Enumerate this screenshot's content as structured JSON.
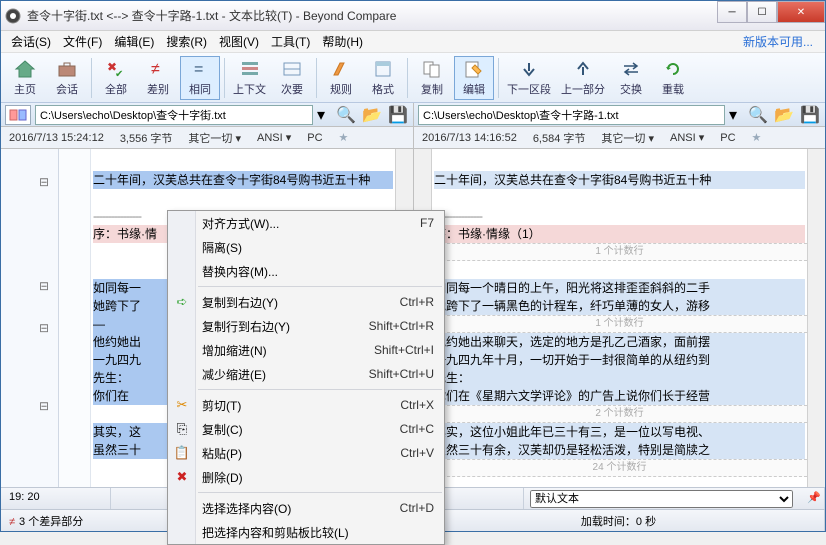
{
  "window": {
    "title": "查令十字街.txt <--> 查令十字路-1.txt - 文本比较(T) - Beyond Compare"
  },
  "menu": {
    "items": [
      "会话(S)",
      "文件(F)",
      "编辑(E)",
      "搜索(R)",
      "视图(V)",
      "工具(T)",
      "帮助(H)"
    ],
    "update": "新版本可用..."
  },
  "toolbar": {
    "home": "主页",
    "session": "会话",
    "all": "全部",
    "diff": "差别",
    "same": "相同",
    "ctx": "上下文",
    "minor": "次要",
    "rules": "规则",
    "format": "格式",
    "copy": "复制",
    "edit": "编辑",
    "nextsec": "下一区段",
    "prevpart": "上一部分",
    "swap": "交换",
    "reload": "重载"
  },
  "left": {
    "path": "C:\\Users\\echo\\Desktop\\查令十字街.txt",
    "ts": "2016/7/13 15:24:12",
    "size": "3,556 字节",
    "enc": "其它一切",
    "charset": "ANSI",
    "eol": "PC",
    "lines": {
      "l1": "二十年间，汉芙总共在查令十字街84号购书近五十种",
      "dash": "----------------",
      "seq": "序：书缘·情",
      "a": "如同每一",
      "b": "她跨下了",
      "c": "—",
      "d": "他约她出",
      "e": "一九四九",
      "f": "先生：",
      "g": "你们在",
      "h": "其实，这",
      "i": "虽然三十"
    }
  },
  "right": {
    "path": "C:\\Users\\echo\\Desktop\\查令十字路-1.txt",
    "ts": "2016/7/13 14:16:52",
    "size": "6,584 字节",
    "enc": "其它一切",
    "charset": "ANSI",
    "eol": "PC",
    "lines": {
      "l1": "二十年间，汉芙总共在查令十字街84号购书近五十种",
      "dash": "----------------",
      "seq": "序：书缘·情缘（1）",
      "gap2": "1 个计数行",
      "a": "如同每一个晴日的上午，阳光将这排歪歪斜斜的二手",
      "b": "她跨下了一辆黑色的计程车，纤巧单薄的女人，游移",
      "gap3": "1 个计数行",
      "d": "他约她出来聊天，选定的地方是孔乙己酒家，面前摆",
      "e": "一九四九年十月，一切开始于一封很简单的从纽约到",
      "f": "先生：",
      "g": "你们在《星期六文学评论》的广告上说你们长于经营",
      "gap4": "2 个计数行",
      "h": "其实，这位小姐此年已三十有三，是一位以写电视、",
      "i": "虽然三十有余，汉芙却仍是轻松活泼，特别是简牍之",
      "gap5": "24 个计数行"
    }
  },
  "ctx": {
    "alignStyle": "对齐方式(W)...",
    "alignSC": "F7",
    "isolate": "隔离(S)",
    "replace": "替换内容(M)...",
    "copyR": "复制到右边(Y)",
    "copyRSC": "Ctrl+R",
    "copyLR": "复制行到右边(Y)",
    "copyLRSC": "Shift+Ctrl+R",
    "inc": "增加缩进(N)",
    "incSC": "Shift+Ctrl+I",
    "dec": "减少缩进(E)",
    "decSC": "Shift+Ctrl+U",
    "cut": "剪切(T)",
    "cutSC": "Ctrl+X",
    "copy": "复制(C)",
    "copySC": "Ctrl+C",
    "paste": "粘贴(P)",
    "pasteSC": "Ctrl+V",
    "del": "删除(D)",
    "selsel": "选择选择内容(O)",
    "selselSC": "Ctrl+D",
    "selclip": "把选择内容和剪贴板比较(L)"
  },
  "status": {
    "pos_l": "19: 20",
    "pos_r": "20",
    "deflabel": "默认文本",
    "diffs": "3 个差异部分",
    "load": "加载时间：0 秒"
  },
  "icons": {
    "search": "🔍",
    "folder": "📂",
    "save": "💾",
    "home": "🏠",
    "sess": "💼",
    "cut": "✂",
    "copy": "⎘",
    "paste": "📋",
    "del": "✖",
    "doc": "📄",
    "arrow": "➡"
  }
}
